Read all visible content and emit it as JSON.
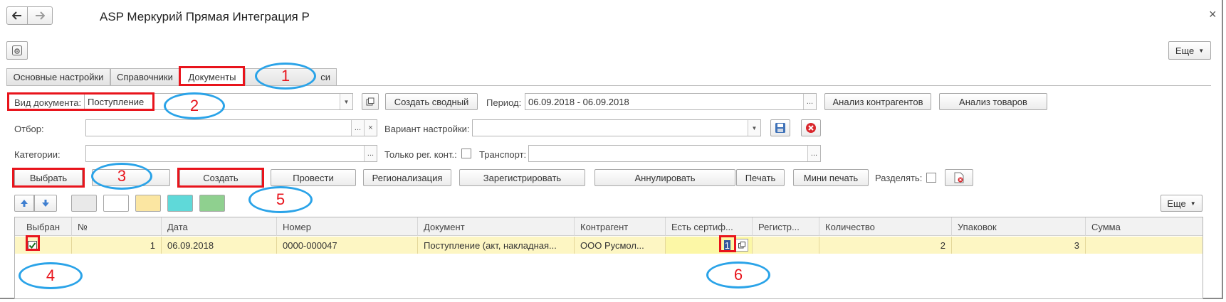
{
  "window": {
    "title": "ASP Меркурий Прямая Интеграция Р",
    "close": "×",
    "more_label": "Еще"
  },
  "tabs": [
    {
      "label": "Основные настройки"
    },
    {
      "label": "Справочники"
    },
    {
      "label": "Документы"
    },
    {
      "label": "си"
    }
  ],
  "filters": {
    "doc_type_label": "Вид документа:",
    "doc_type_value": "Поступление",
    "create_summary": "Создать сводный",
    "period_label": "Период:",
    "period_value": "06.09.2018 - 06.09.2018",
    "analyze_counterparties": "Анализ контрагентов",
    "analyze_goods": "Анализ товаров",
    "selection_label": "Отбор:",
    "variant_label": "Вариант настройки:",
    "categories_label": "Категории:",
    "only_reg_label": "Только рег. конт.:",
    "transport_label": "Транспорт:"
  },
  "actions": {
    "select": "Выбрать",
    "create": "Создать",
    "post": "Провести",
    "regionalize": "Регионализация",
    "register": "Зарегистрировать",
    "cancel_doc": "Аннулировать",
    "print": "Печать",
    "mini_print": "Мини печать",
    "split_label": "Разделять:",
    "more_label": "Еще"
  },
  "colors": {
    "swatches": [
      "#e9e9e9",
      "#ffffff",
      "#fbe6a2",
      "#5fd9d9",
      "#8fd08f"
    ],
    "row_highlight": "#fdf6c3",
    "annotation_red": "#e8141c",
    "annotation_blue": "#2aa3e8"
  },
  "table": {
    "headers": [
      "Выбран",
      "№",
      "Дата",
      "Номер",
      "Документ",
      "Контрагент",
      "Есть сертиф...",
      "Регистр...",
      "Количество",
      "Упаковок",
      "Сумма"
    ],
    "rows": [
      {
        "selected": true,
        "num": "1",
        "date": "06.09.2018",
        "number": "0000-000047",
        "document": "Поступление (акт, накладная...",
        "counterparty": "ООО Русмол...",
        "has_cert": "1",
        "register": "",
        "quantity": "2",
        "packages": "3",
        "sum": ""
      }
    ]
  },
  "annotations": [
    "1",
    "2",
    "3",
    "4",
    "5",
    "6"
  ]
}
